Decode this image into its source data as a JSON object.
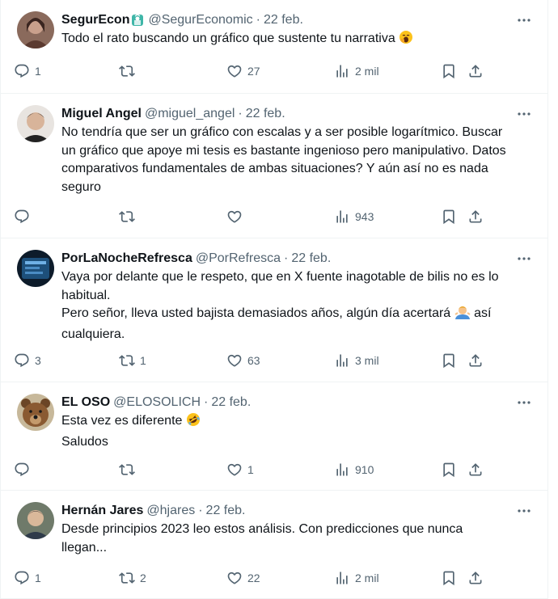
{
  "colors": {
    "text": "#0f1419",
    "secondary": "#536471",
    "border": "#eff3f4"
  },
  "tweets": [
    {
      "name": "SegurEcon",
      "badge_icon": "statue-of-liberty-emoji",
      "handle": "@SegurEconomic",
      "date": "22 feb.",
      "text": "Todo el rato buscando un gráfico que sustente tu narrativa",
      "text_emoji": "yawning-face-emoji",
      "replies": "1",
      "retweets": "",
      "likes": "27",
      "views": "2 mil"
    },
    {
      "name": "Miguel Angel",
      "handle": "@miguel_angel",
      "date": "22 feb.",
      "text": "No tendría que ser un gráfico con escalas y a ser posible logarítmico. Buscar un gráfico que apoye mi tesis es bastante ingenioso pero manipulativo. Datos comparativos fundamentales de ambas situaciones? Y aún así no es nada seguro",
      "replies": "",
      "retweets": "",
      "likes": "",
      "views": "943"
    },
    {
      "name": "PorLaNocheRefresca",
      "handle": "@PorRefresca",
      "date": "22 feb.",
      "text_1": "Vaya por delante que le respeto, que en X fuente inagotable de bilis no es lo habitual.",
      "text_2a": "Pero señor, lleva usted bajista demasiados años, algún día acertará",
      "text_emoji": "man-shrugging-emoji",
      "text_2b": "así cualquiera.",
      "replies": "3",
      "retweets": "1",
      "likes": "63",
      "views": "3 mil"
    },
    {
      "name": "EL OSO",
      "handle": "@ELOSOLICH",
      "date": "22 feb.",
      "text_1": "Esta vez es diferente",
      "text_emoji": "rolling-on-floor-laughing-emoji",
      "text_2": "Saludos",
      "replies": "",
      "retweets": "",
      "likes": "1",
      "views": "910"
    },
    {
      "name": "Hernán Jares",
      "handle": "@hjares",
      "date": "22 feb.",
      "text": "Desde principios 2023 leo estos análisis. Con predicciones que nunca llegan...",
      "replies": "1",
      "retweets": "2",
      "likes": "22",
      "views": "2 mil"
    }
  ]
}
